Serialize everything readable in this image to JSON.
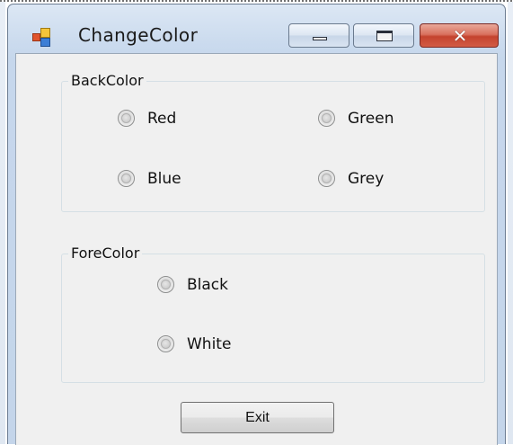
{
  "window": {
    "title": "ChangeColor",
    "icon": "windows-form-icon",
    "controls": {
      "minimize_icon": "minimize-icon",
      "maximize_icon": "maximize-icon",
      "close_icon": "close-icon",
      "close_glyph": "✕"
    }
  },
  "backcolor_group": {
    "label": "BackColor",
    "options": [
      {
        "label": "Red",
        "checked": false
      },
      {
        "label": "Green",
        "checked": false
      },
      {
        "label": "Blue",
        "checked": false
      },
      {
        "label": "Grey",
        "checked": false
      }
    ]
  },
  "forecolor_group": {
    "label": "ForeColor",
    "options": [
      {
        "label": "Black",
        "checked": false
      },
      {
        "label": "White",
        "checked": false
      }
    ]
  },
  "exit_button": {
    "label": "Exit"
  },
  "colors": {
    "titlebar": "#cbdbee",
    "client_background": "#f0f0f0",
    "close_button": "#c4432e"
  }
}
